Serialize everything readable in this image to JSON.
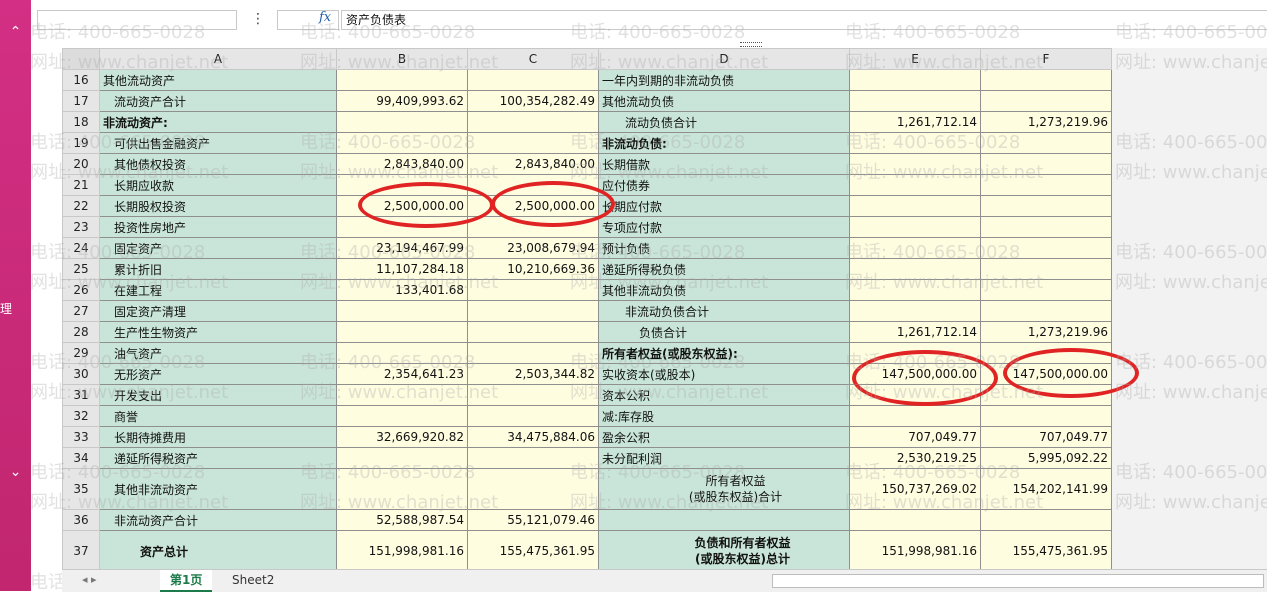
{
  "formula_bar": {
    "fx_label": "fx",
    "more_label": "⋮",
    "value": "资产负债表"
  },
  "left_rail": {
    "up": "⌃",
    "down": "⌄",
    "mid_label": "理"
  },
  "columns": [
    "A",
    "B",
    "C",
    "D",
    "E",
    "F"
  ],
  "rows": [
    {
      "n": "16",
      "a": "其他流动资产",
      "b": "",
      "c": "",
      "d": "一年内到期的非流动负债",
      "e": "",
      "f": ""
    },
    {
      "n": "17",
      "a": "流动资产合计",
      "b": "99,409,993.62",
      "c": "100,354,282.49",
      "d": "其他流动负债",
      "e": "",
      "f": ""
    },
    {
      "n": "18",
      "a": "非流动资产:",
      "b": "",
      "c": "",
      "d": "流动负债合计",
      "e": "1,261,712.14",
      "f": "1,273,219.96"
    },
    {
      "n": "19",
      "a": "可供出售金融资产",
      "b": "",
      "c": "",
      "d": "非流动负债:",
      "e": "",
      "f": ""
    },
    {
      "n": "20",
      "a": "其他债权投资",
      "b": "2,843,840.00",
      "c": "2,843,840.00",
      "d": "长期借款",
      "e": "",
      "f": ""
    },
    {
      "n": "21",
      "a": "长期应收款",
      "b": "",
      "c": "",
      "d": "应付债券",
      "e": "",
      "f": ""
    },
    {
      "n": "22",
      "a": "长期股权投资",
      "b": "2,500,000.00",
      "c": "2,500,000.00",
      "d": "长期应付款",
      "e": "",
      "f": ""
    },
    {
      "n": "23",
      "a": "投资性房地产",
      "b": "",
      "c": "",
      "d": "专项应付款",
      "e": "",
      "f": ""
    },
    {
      "n": "24",
      "a": "固定资产",
      "b": "23,194,467.99",
      "c": "23,008,679.94",
      "d": "预计负债",
      "e": "",
      "f": ""
    },
    {
      "n": "25",
      "a": "累计折旧",
      "b": "11,107,284.18",
      "c": "10,210,669.36",
      "d": "递延所得税负债",
      "e": "",
      "f": ""
    },
    {
      "n": "26",
      "a": "在建工程",
      "b": "133,401.68",
      "c": "",
      "d": "其他非流动负债",
      "e": "",
      "f": ""
    },
    {
      "n": "27",
      "a": "固定资产清理",
      "b": "",
      "c": "",
      "d": "非流动负债合计",
      "e": "",
      "f": ""
    },
    {
      "n": "28",
      "a": "生产性生物资产",
      "b": "",
      "c": "",
      "d": "负债合计",
      "e": "1,261,712.14",
      "f": "1,273,219.96"
    },
    {
      "n": "29",
      "a": "油气资产",
      "b": "",
      "c": "",
      "d": "所有者权益(或股东权益):",
      "e": "",
      "f": ""
    },
    {
      "n": "30",
      "a": "无形资产",
      "b": "2,354,641.23",
      "c": "2,503,344.82",
      "d": "实收资本(或股本)",
      "e": "147,500,000.00",
      "f": "147,500,000.00"
    },
    {
      "n": "31",
      "a": "开发支出",
      "b": "",
      "c": "",
      "d": "资本公积",
      "e": "",
      "f": ""
    },
    {
      "n": "32",
      "a": "商誉",
      "b": "",
      "c": "",
      "d": "减:库存股",
      "e": "",
      "f": ""
    },
    {
      "n": "33",
      "a": "长期待摊费用",
      "b": "32,669,920.82",
      "c": "34,475,884.06",
      "d": "盈余公积",
      "e": "707,049.77",
      "f": "707,049.77"
    },
    {
      "n": "34",
      "a": "递延所得税资产",
      "b": "",
      "c": "",
      "d": "未分配利润",
      "e": "2,530,219.25",
      "f": "5,995,092.22"
    },
    {
      "n": "35",
      "a": "其他非流动资产",
      "b": "",
      "c": "",
      "d": "所有者权益\n(或股东权益)合计",
      "e": "150,737,269.02",
      "f": "154,202,141.99"
    },
    {
      "n": "36",
      "a": "非流动资产合计",
      "b": "52,588,987.54",
      "c": "55,121,079.46",
      "d": "",
      "e": "",
      "f": ""
    },
    {
      "n": "37",
      "a": "资产总计",
      "b": "151,998,981.16",
      "c": "155,475,361.95",
      "d": "负债和所有者权益\n(或股东权益)总计",
      "e": "151,998,981.16",
      "f": "155,475,361.95"
    }
  ],
  "tabs": {
    "nav": "◂ ▸",
    "active": "第1页",
    "second": "Sheet2"
  },
  "watermark": {
    "phone": "电话: 400-665-0028",
    "site": "网址: www.chanjet.net"
  },
  "colors": {
    "accent_rail": "#c1266f",
    "label_fill": "#c9e5d9",
    "value_fill": "#fffde0",
    "annotation": "#e02424"
  }
}
